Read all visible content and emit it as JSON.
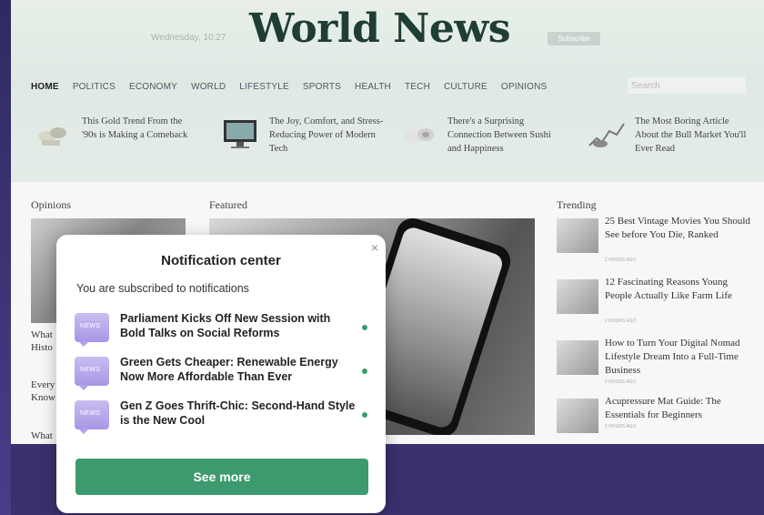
{
  "masthead": {
    "date": "Wednesday, 10:27",
    "title": "World News",
    "subscribe_label": "Subscribe"
  },
  "nav": {
    "items": [
      "HOME",
      "POLITICS",
      "ECONOMY",
      "WORLD",
      "LIFESTYLE",
      "SPORTS",
      "HEALTH",
      "TECH",
      "CULTURE",
      "OPINIONS"
    ],
    "search_placeholder": "Search"
  },
  "promos": [
    {
      "title": "This Gold Trend From the '90s is Making a Comeback",
      "icon": "gold-jewelry-icon"
    },
    {
      "title": "The Joy, Comfort, and Stress-Reducing Power of Modern Tech",
      "icon": "monitor-icon"
    },
    {
      "title": "There's a Surprising Connection Between Sushi and Happiness",
      "icon": "sushi-icon"
    },
    {
      "title": "The Most Boring Article About the Bull Market You'll Ever Read",
      "icon": "bull-icon"
    }
  ],
  "sections": {
    "opinions_label": "Opinions",
    "featured_label": "Featured",
    "trending_label": "Trending"
  },
  "opinions": {
    "line1": "What",
    "line2": "Histo",
    "line3": "Every",
    "line4": "Know",
    "line5": "What"
  },
  "trending": [
    {
      "title": "25 Best Vintage Movies You Should See before You Die, Ranked",
      "meta": "2 HOURS AGO"
    },
    {
      "title": "12 Fascinating Reasons Young People Actually Like Farm Life",
      "meta": "2 HOURS AGO"
    },
    {
      "title": "How to Turn Your Digital Nomad Lifestyle Dream Into a Full-Time Business",
      "meta": "2 HOURS AGO"
    },
    {
      "title": "Acupressure Mat Guide: The Essentials for Beginners",
      "meta": "2 HOURS AGO"
    }
  ],
  "notification_center": {
    "title": "Notification center",
    "subtitle": "You are subscribed to notifications",
    "close_glyph": "×",
    "icon_tag": "NEWS",
    "items": [
      {
        "text": "Parliament Kicks Off New Session with Bold Talks on Social Reforms"
      },
      {
        "text": "Green Gets Cheaper: Renewable Energy Now More Affordable Than Ever"
      },
      {
        "text": "Gen Z Goes Thrift-Chic: Second-Hand Style is the New Cool"
      }
    ],
    "see_more_label": "See more"
  },
  "colors": {
    "accent": "#3d9a6e",
    "unread_dot": "#3f9a6c",
    "news_icon": "#b3a2ea",
    "logo": "#1f3d34"
  }
}
